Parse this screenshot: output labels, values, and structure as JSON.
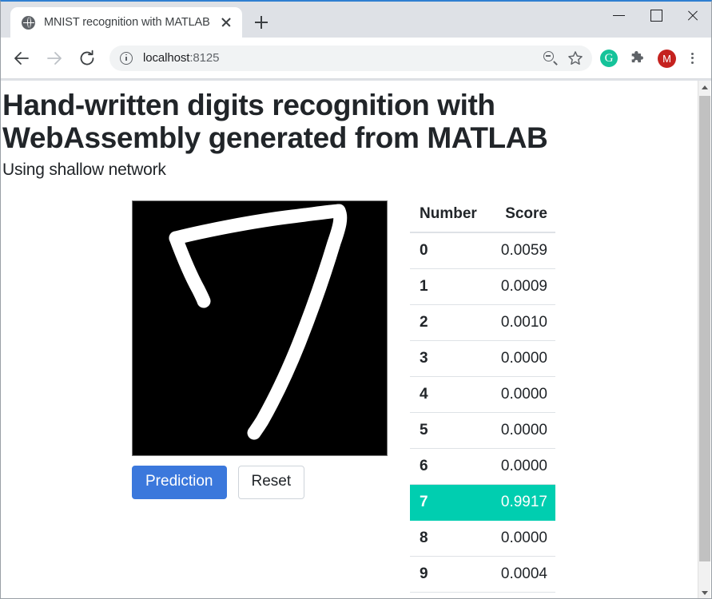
{
  "browser": {
    "tab": {
      "title": "MNIST recognition with MATLAB",
      "favicon": "globe-icon",
      "close_icon": "close-icon"
    },
    "new_tab_icon": "plus-icon",
    "window_controls": {
      "minimize": "minimize-icon",
      "maximize": "maximize-icon",
      "close": "close-icon"
    },
    "toolbar": {
      "back_icon": "back-arrow-icon",
      "forward_icon": "forward-arrow-icon",
      "reload_icon": "reload-icon",
      "site_info_icon": "info-circle-icon",
      "url_host": "localhost",
      "url_port": ":8125",
      "zoom_out_icon": "zoom-out-magnifier-icon",
      "bookmark_icon": "star-icon",
      "grammarly_icon_letter": "G",
      "extensions_icon": "puzzle-piece-icon",
      "profile_avatar_letter": "M",
      "menu_icon": "three-dot-menu-icon"
    },
    "scrollbar": {
      "up_arrow_icon": "chevron-up-icon",
      "down_arrow_icon": "chevron-down-icon"
    }
  },
  "page": {
    "title": "Hand-written digits recognition with WebAssembly generated from MATLAB",
    "subtitle": "Using shallow network",
    "canvas": {
      "name": "digit-drawing-canvas",
      "drawn_digit": "7",
      "background_color": "#000000",
      "stroke_color": "#ffffff"
    },
    "buttons": {
      "prediction_label": "Prediction",
      "reset_label": "Reset",
      "prediction_color": "#3b78dc"
    },
    "table": {
      "headers": [
        "Number",
        "Score"
      ],
      "highlight_color": "#00ceb0",
      "highlight_index": 7,
      "rows": [
        {
          "number": "0",
          "score": "0.0059"
        },
        {
          "number": "1",
          "score": "0.0009"
        },
        {
          "number": "2",
          "score": "0.0010"
        },
        {
          "number": "3",
          "score": "0.0000"
        },
        {
          "number": "4",
          "score": "0.0000"
        },
        {
          "number": "5",
          "score": "0.0000"
        },
        {
          "number": "6",
          "score": "0.0000"
        },
        {
          "number": "7",
          "score": "0.9917"
        },
        {
          "number": "8",
          "score": "0.0000"
        },
        {
          "number": "9",
          "score": "0.0004"
        }
      ]
    }
  }
}
